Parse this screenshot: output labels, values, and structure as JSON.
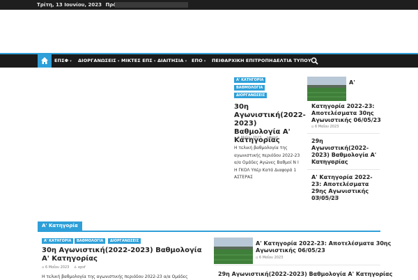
{
  "topbar": {
    "date": "Τρίτη, 13 Ιουνίου, 2023",
    "latest_label": "Πρόσφατα:"
  },
  "nav": {
    "items": [
      "ΕΠΣΦ",
      "ΔΙΟΡΓΑΝΩΣΕΙΣ",
      "ΜΙΚΤΕΣ ΕΠΣ",
      "ΔΙΑΙΤΗΣΙΑ",
      "ΕΠΟ",
      "ΠΕΙΘΑΡΧΙΚΗ ΕΠΙΤΡΟΠΗ",
      "ΔΕΛΤΙΑ ΤΥΠΟΥ"
    ],
    "has_dropdown": [
      true,
      true,
      true,
      true,
      true,
      false,
      false
    ]
  },
  "featured": {
    "tags": [
      "Α' ΚΑΤΗΓΟΡΙΑ",
      "ΒΑΘΜΟΛΟΓΙΑ",
      "ΔΙΟΡΓΑΝΩΣΕΙΣ"
    ],
    "title": "30η Αγωνιστική(2022-2023) Βαθμολογία Α' Κατηγορίας",
    "date": "6 Μαΐου 2023",
    "author": "epsf",
    "excerpt": "Η τελική βαθμολογία της αγωνιστικής περιόδου 2022-23 α/α Ομάδες Αγώνες Βαθμοί Ν Ι Η ΓΚΟΛ Υπέρ Κατά Διαφορά 1 ΑΣΤΕΡΑΣ"
  },
  "side_posts": [
    {
      "title": "Α' Κατηγορία 2022-23: Αποτελέσματα 30ης Αγωνιστικής 06/05/23",
      "title_start": "Α'",
      "title_rest": "Κατηγορία 2022-23: Αποτελέσματα 30ης Αγωνιστικής 06/05/23",
      "date": "6 Μαΐου 2023"
    },
    {
      "title": "29η Αγωνιστική(2022-2023) Βαθμολογία Α' Κατηγορίας",
      "date": "3 Μαΐου 2023"
    },
    {
      "title": "Α' Κατηγορία 2022-23: Αποτελέσματα 29ης Αγωνιστικής 03/05/23",
      "date": "3 Μαΐου 2023"
    }
  ],
  "section": {
    "label": "Α' Κατηγορία",
    "tags": [
      "Α' ΚΑΤΗΓΟΡΙΑ",
      "ΒΑΘΜΟΛΟΓΙΑ",
      "ΔΙΟΡΓΑΝΩΣΕΙΣ"
    ],
    "title": "30η Αγωνιστική(2022-2023) Βαθμολογία Α' Κατηγορίας",
    "date": "6 Μαΐου 2023",
    "author": "epsf",
    "excerpt": "Η τελική βαθμολογία της αγωνιστικής περιόδου 2022-23 α/α Ομάδες",
    "side_posts": [
      {
        "title_line1": "Α' Κατηγορία 2022-23: Αποτελέσματα 30ης",
        "title_line2": "Αγωνιστικής 06/05/23",
        "date": "6 Μαΐου 2023"
      },
      {
        "title": "29η Αγωνιστική(2022-2023) Βαθμολογία Α' Κατηγορίας"
      }
    ]
  },
  "colors": {
    "accent": "#2e9fd8",
    "nav_bg": "#1b1b1b",
    "topbar_bg": "#1e1e1e"
  },
  "icons": [
    "home-icon",
    "search-icon",
    "calendar-icon",
    "user-icon"
  ]
}
